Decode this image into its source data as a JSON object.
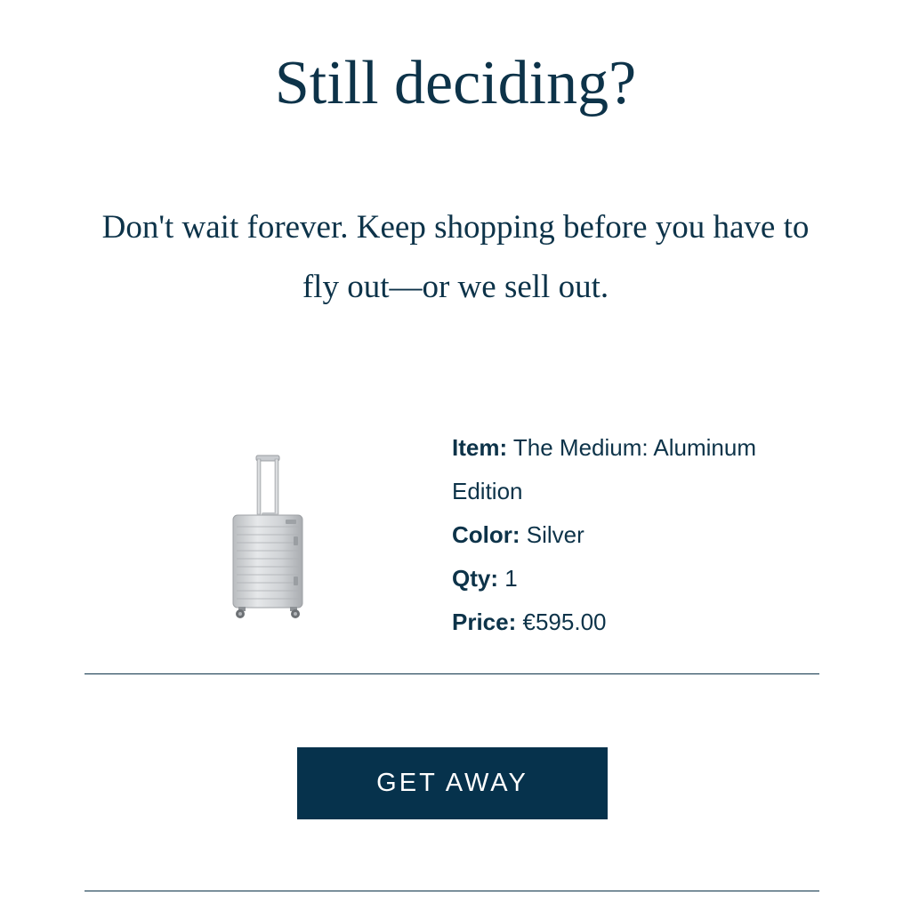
{
  "headline": "Still deciding?",
  "subcopy": "Don't wait forever. Keep shopping before you have to fly out—or we sell out.",
  "product": {
    "image_icon": "silver-suitcase-image",
    "item_label": "Item:",
    "item_value": "The Medium: Aluminum Edition",
    "color_label": "Color:",
    "color_value": "Silver",
    "qty_label": "Qty:",
    "qty_value": "1",
    "price_label": "Price:",
    "price_value": "€595.00"
  },
  "cta": {
    "label": "GET AWAY"
  },
  "colors": {
    "brand_navy": "#0d3349",
    "button_bg": "#06324c",
    "button_text": "#ffffff"
  }
}
